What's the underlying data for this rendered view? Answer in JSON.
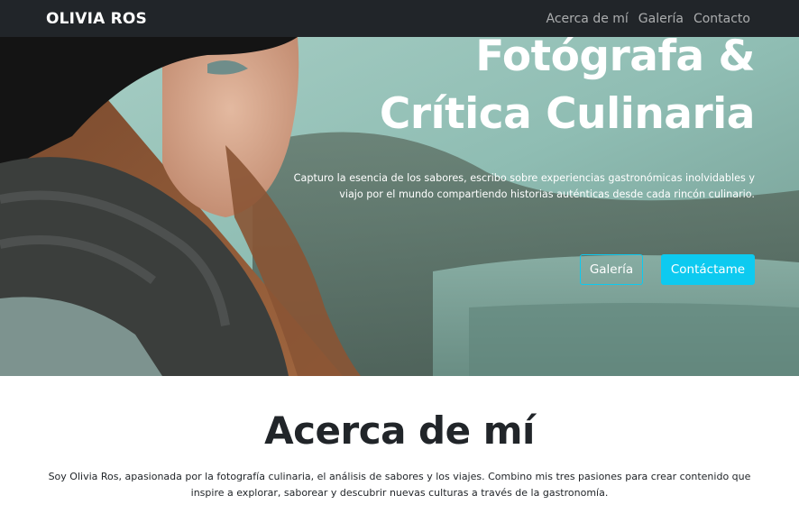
{
  "navbar": {
    "brand": "OLIVIA ROS",
    "links": [
      "Acerca de mí",
      "Galería",
      "Contacto"
    ]
  },
  "hero": {
    "title_line1": "Fotógrafa &",
    "title_line2": "Crítica Culinaria",
    "description": "Capturo la esencia de los sabores, escribo sobre experiencias gastronómicas inolvidables y viajo por el mundo compartiendo historias auténticas desde cada rincón culinario.",
    "buttons": {
      "gallery": "Galería",
      "contact": "Contáctame"
    }
  },
  "about": {
    "title": "Acerca de mí",
    "text": "Soy Olivia Ros, apasionada por la fotografía culinaria, el análisis de sabores y los viajes. Combino mis tres pasiones para crear contenido que inspire a explorar, saborear y descubrir nuevas culturas a través de la gastronomía."
  },
  "colors": {
    "navbar_bg": "#212529",
    "accent": "#0dcaf0",
    "text_dark": "#212529"
  }
}
